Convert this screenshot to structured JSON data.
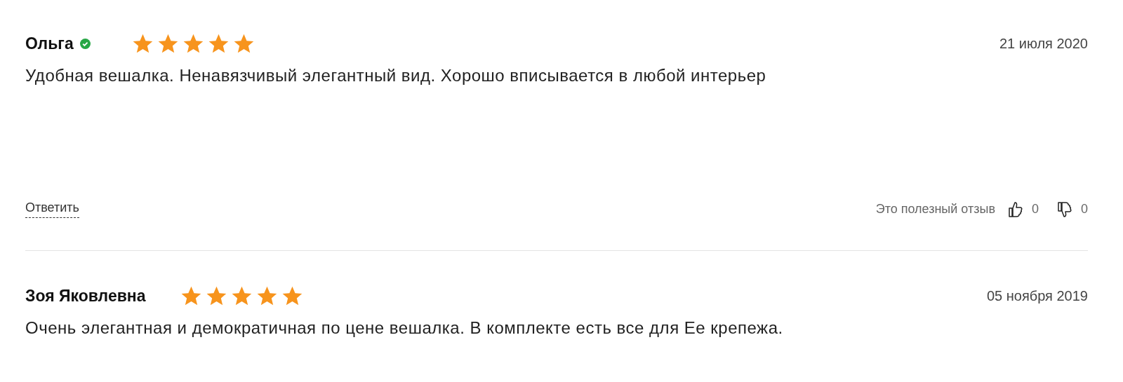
{
  "reviews": [
    {
      "author": "Ольга",
      "verified": true,
      "stars": 5,
      "date": "21 июля 2020",
      "text": "Удобная вешалка. Ненавязчивый элегантный вид. Хорошо вписывается в любой интерьер",
      "footer": {
        "reply": "Ответить",
        "helpful_label": "Это полезный отзыв",
        "likes": "0",
        "dislikes": "0"
      }
    },
    {
      "author": "Зоя Яковлевна",
      "verified": false,
      "stars": 5,
      "date": "05 ноября 2019",
      "text": "Очень элегантная и демократичная по цене вешалка. В комплекте есть все для Ее крепежа."
    }
  ]
}
